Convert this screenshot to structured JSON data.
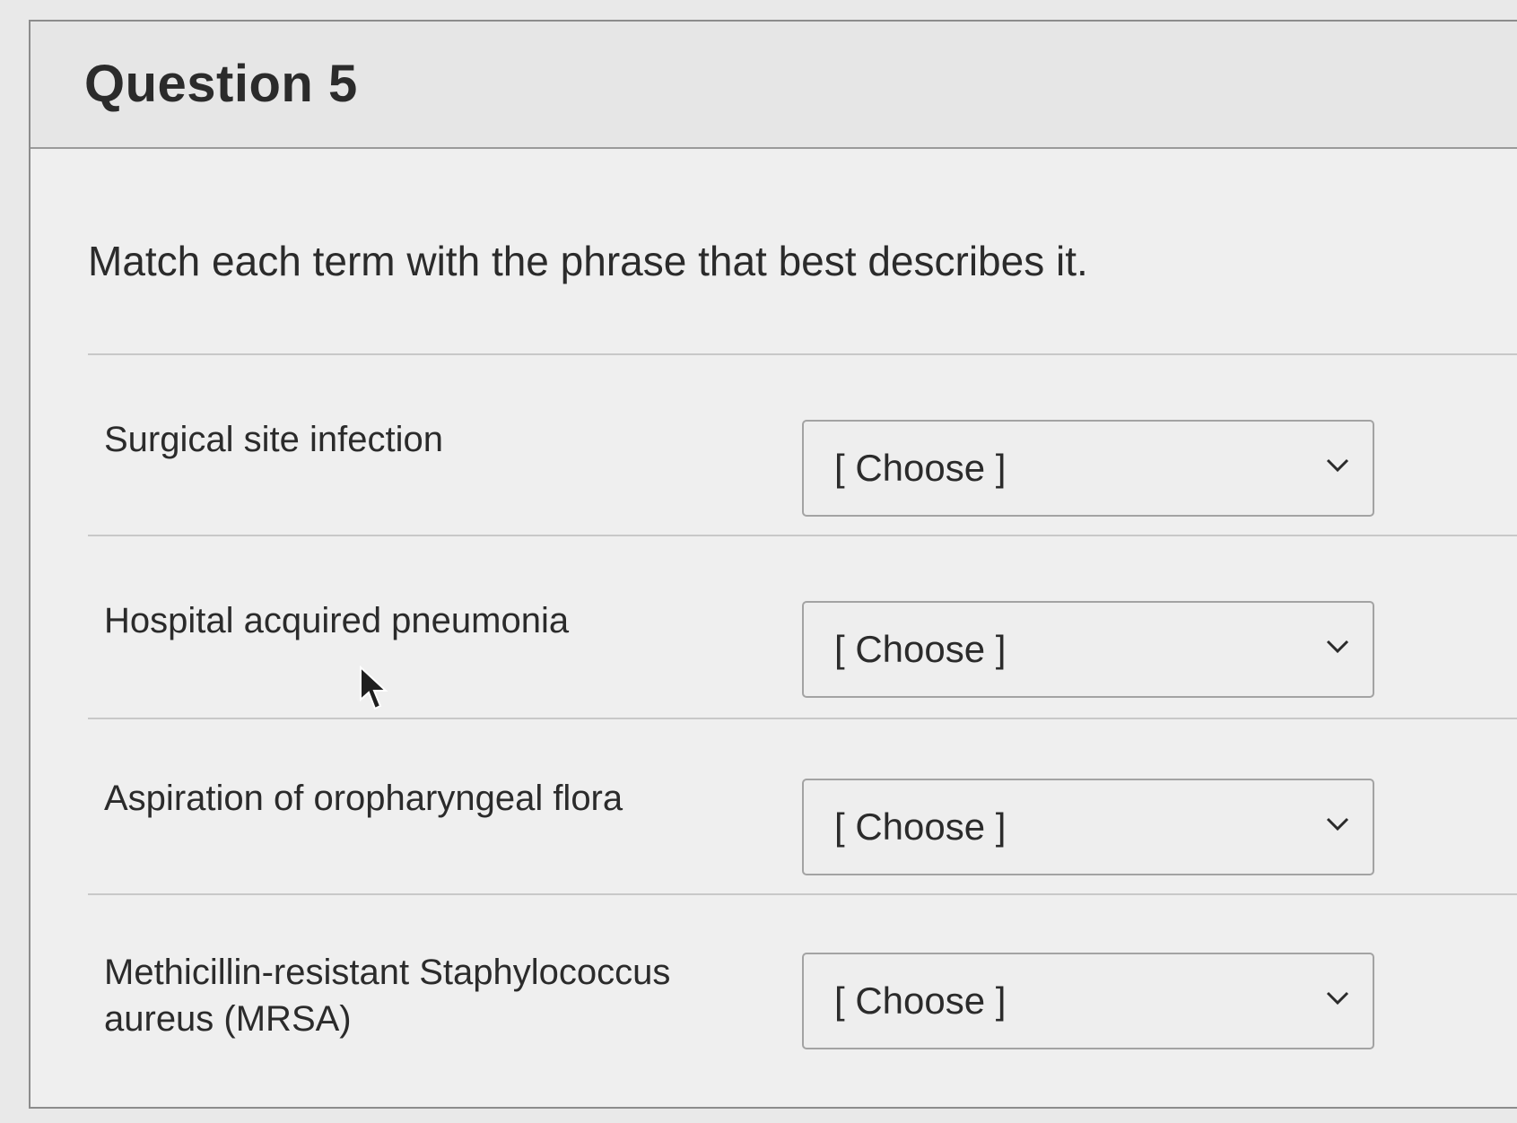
{
  "question": {
    "title": "Question 5",
    "prompt": "Match each term with the phrase that best describes it."
  },
  "matches": [
    {
      "term": "Surgical site infection",
      "selected": "[ Choose ]"
    },
    {
      "term": "Hospital acquired pneumonia",
      "selected": "[ Choose ]"
    },
    {
      "term": "Aspiration of oropharyngeal flora",
      "selected": "[ Choose ]"
    },
    {
      "term": "Methicillin-resistant Staphylococcus aureus (MRSA)",
      "selected": "[ Choose ]"
    }
  ],
  "icons": {
    "dropdown": "chevron-down-icon",
    "pointer": "mouse-cursor-icon"
  }
}
